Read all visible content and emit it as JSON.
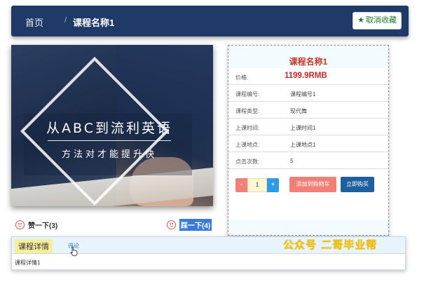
{
  "header": {
    "breadcrumb_home": "首页",
    "breadcrumb_separator": "/",
    "breadcrumb_current": "课程名称1",
    "favorite_button": "取消收藏",
    "favorite_icon": "star-icon"
  },
  "banner": {
    "title": "从ABC到流利英语",
    "subtitle": "方法对才能提升快"
  },
  "votes": {
    "like_label": "赞一下(3)",
    "dislike_label": "踩一下(4)",
    "icon": "smile-icon"
  },
  "course": {
    "name": "课程名称1",
    "price_label": "价格:",
    "price": "1199.9RMB",
    "rows": [
      {
        "label": "课程编号:",
        "value": "课程编号1"
      },
      {
        "label": "课程类型:",
        "value": "现代舞"
      },
      {
        "label": "上课时间:",
        "value": "上课时间1"
      },
      {
        "label": "上课地点:",
        "value": "上课地点1"
      },
      {
        "label": "点击次数:",
        "value": "5"
      }
    ]
  },
  "purchase": {
    "minus": "-",
    "quantity": "1",
    "plus": "+",
    "add_to_cart": "添加到购物车",
    "buy_now": "立即购买"
  },
  "tabs": {
    "detail": "课程详情",
    "comments": "评论",
    "content": "课程详情1"
  },
  "watermark": "公众号 二哥毕业帮",
  "colors": {
    "header_bg": "#1f3a66",
    "price": "#c62828",
    "cart_button": "#f27f77",
    "buy_button": "#1f5f9e",
    "active_tab": "#f6ee9a"
  }
}
